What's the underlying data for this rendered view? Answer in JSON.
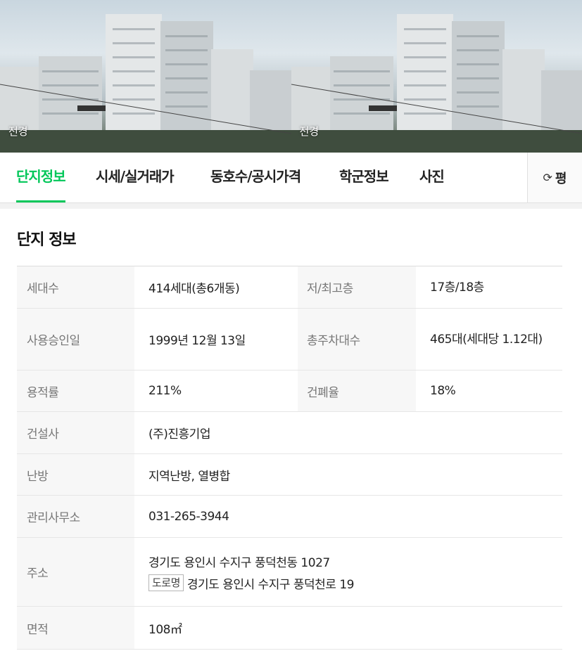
{
  "banner": {
    "photos": [
      {
        "caption": "전경"
      },
      {
        "caption": "전경"
      }
    ]
  },
  "tabs": [
    {
      "label": "단지정보",
      "active": true
    },
    {
      "label": "시세/실거래가",
      "active": false
    },
    {
      "label": "동호수/공시가격",
      "active": false
    },
    {
      "label": "학군정보",
      "active": false
    },
    {
      "label": "사진",
      "active": false
    }
  ],
  "unit_toggle": {
    "icon": "refresh-icon",
    "label": "평"
  },
  "section": {
    "title": "단지 정보"
  },
  "info": {
    "households_label": "세대수",
    "households": "414세대(총6개동)",
    "floors_label": "저/최고층",
    "floors": "17층/18층",
    "approval_label": "사용승인일",
    "approval": "1999년 12월 13일",
    "parking_label": "총주차대수",
    "parking": "465대(세대당 1.12대)",
    "far_label": "용적률",
    "far": "211%",
    "bcr_label": "건폐율",
    "bcr": "18%",
    "builder_label": "건설사",
    "builder": "(주)진흥기업",
    "heating_label": "난방",
    "heating": "지역난방, 열병합",
    "office_label": "관리사무소",
    "office": "031-265-3944",
    "address_label": "주소",
    "address_lot": "경기도 용인시 수지구 풍덕천동 1027",
    "road_badge": "도로명",
    "address_road": "경기도 용인시 수지구 풍덕천로 19",
    "area_label": "면적",
    "area": "108㎡"
  },
  "colors": {
    "accent": "#03c75a",
    "label_bg": "#f7f7f7"
  }
}
